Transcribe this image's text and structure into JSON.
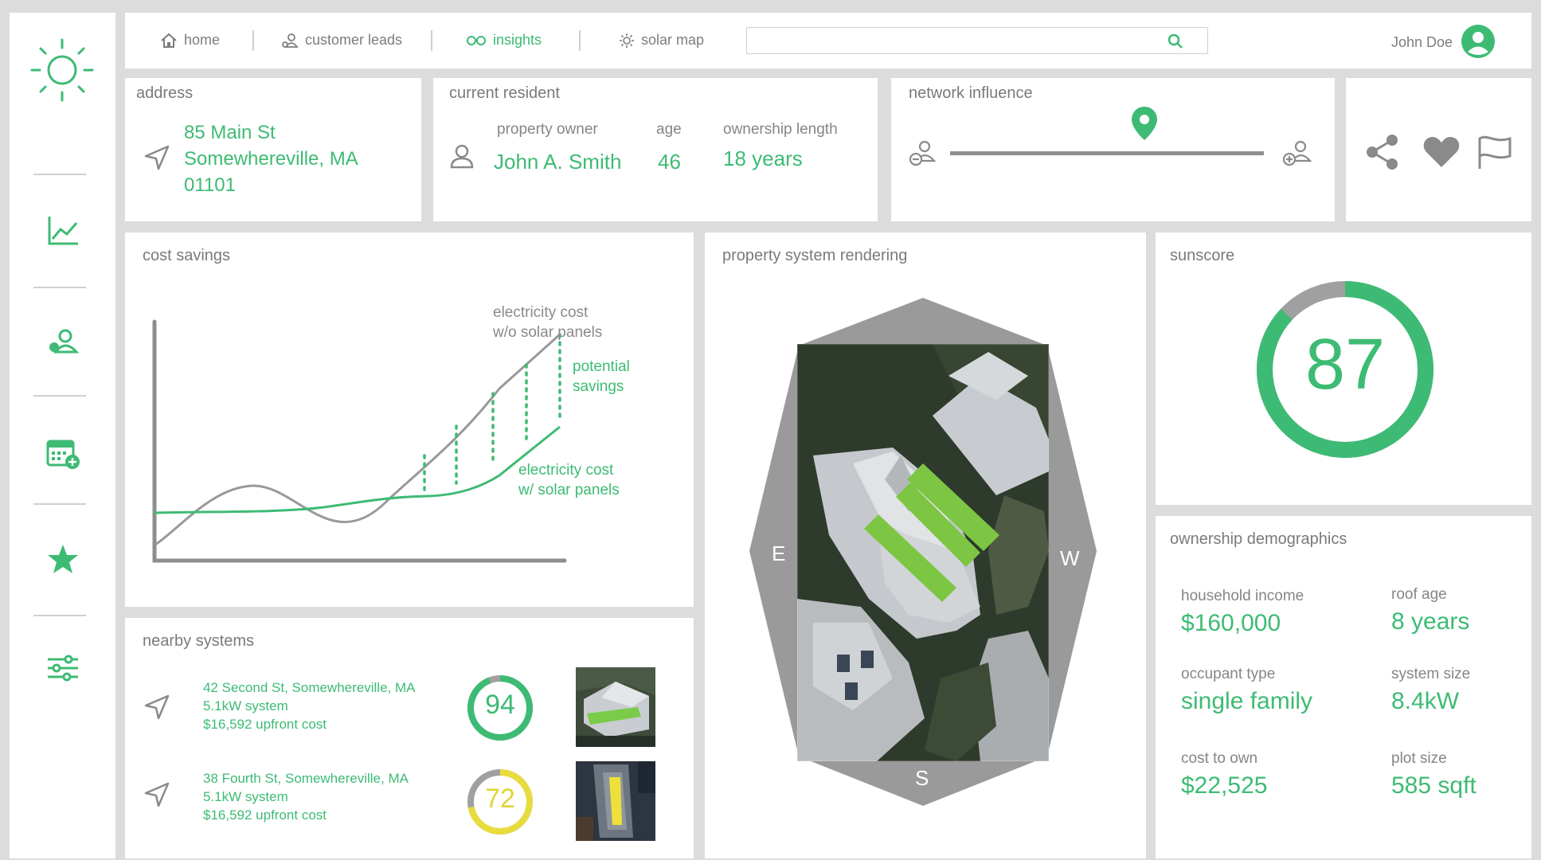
{
  "nav": {
    "items": [
      {
        "label": "home",
        "icon": "home-icon"
      },
      {
        "label": "customer leads",
        "icon": "people-icon"
      },
      {
        "label": "insights",
        "icon": "glasses-icon",
        "active": true
      },
      {
        "label": "solar map",
        "icon": "sun-icon"
      }
    ],
    "search_placeholder": "",
    "user_name": "John Doe"
  },
  "sidebar": {
    "items": [
      "sun-logo-icon",
      "chart-icon",
      "leads-icon",
      "calendar-add-icon",
      "star-icon",
      "sliders-icon"
    ]
  },
  "address": {
    "title": "address",
    "line1": "85 Main St",
    "line2": "Somewhereville, MA",
    "line3": "01101"
  },
  "resident": {
    "title": "current resident",
    "owner_label": "property owner",
    "owner_value": "John A. Smith",
    "age_label": "age",
    "age_value": "46",
    "ownership_label": "ownership length",
    "ownership_value": "18 years"
  },
  "network": {
    "title": "network influence",
    "level": 0.62
  },
  "cost_savings": {
    "title": "cost savings",
    "label_without": [
      "electricity cost",
      "w/o solar panels"
    ],
    "label_savings": [
      "potential",
      "savings"
    ],
    "label_with": [
      "electricity cost",
      "w/ solar panels"
    ]
  },
  "rendering": {
    "title": "property system rendering",
    "compass": {
      "east": "E",
      "west": "W",
      "south": "S"
    }
  },
  "sunscore": {
    "title": "sunscore",
    "value": "87",
    "fraction": 0.87
  },
  "demographics": {
    "title": "ownership demographics",
    "income_label": "household income",
    "income_value": "$160,000",
    "roof_label": "roof age",
    "roof_value": "8 years",
    "occupant_label": "occupant type",
    "occupant_value": "single family",
    "system_label": "system size",
    "system_value": "8.4kW",
    "cost_label": "cost to own",
    "cost_value": "$22,525",
    "plot_label": "plot size",
    "plot_value": "585 sqft"
  },
  "nearby": {
    "title": "nearby systems",
    "items": [
      {
        "address": "42 Second St, Somewhereville, MA",
        "system": "5.1kW system",
        "cost": "$16,592 upfront cost",
        "score": "94",
        "score_fraction": 0.94,
        "color": "#3dbb74"
      },
      {
        "address": "38 Fourth St, Somewhereville, MA",
        "system": "5.1kW system",
        "cost": "$16,592 upfront cost",
        "score": "72",
        "score_fraction": 0.72,
        "color": "#e8dc3c"
      }
    ]
  },
  "colors": {
    "accent": "#3dbb74",
    "gray": "#9a9a9a",
    "yellow": "#e8dc3c"
  }
}
